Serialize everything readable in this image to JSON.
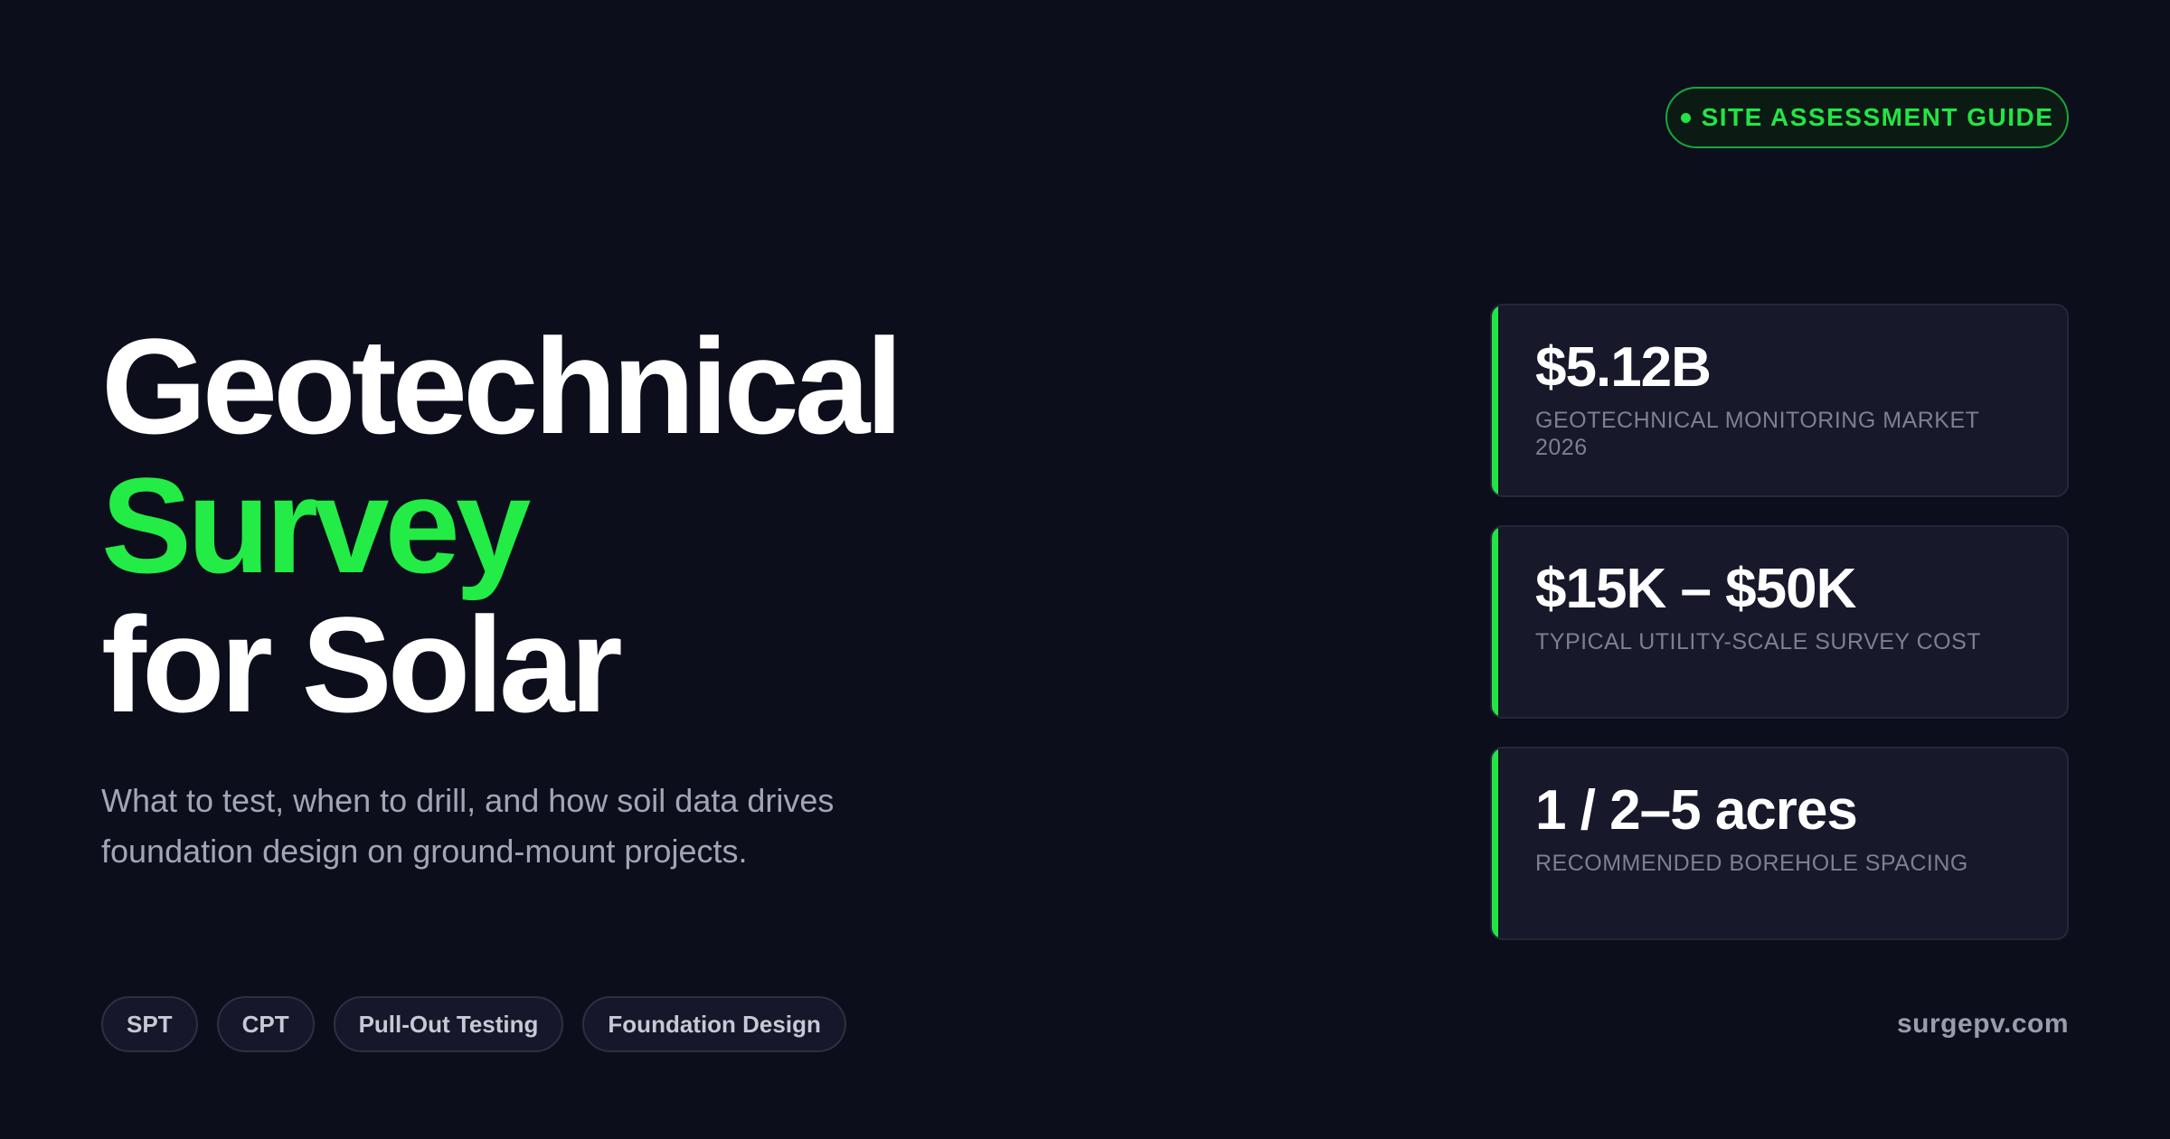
{
  "badge": {
    "label": "SITE ASSESSMENT GUIDE"
  },
  "headline": {
    "line1": "Geotechnical",
    "line2": "Survey",
    "line3": "for Solar"
  },
  "subtitle": "What to test, when to drill, and how soil data drives foundation design on ground-mount projects.",
  "stats": [
    {
      "value": "$5.12B",
      "label": "GEOTECHNICAL MONITORING MARKET 2026"
    },
    {
      "value": "$15K – $50K",
      "label": "TYPICAL UTILITY-SCALE SURVEY COST"
    },
    {
      "value": "1 / 2–5 acres",
      "label": "RECOMMENDED BOREHOLE SPACING"
    }
  ],
  "tags": [
    "SPT",
    "CPT",
    "Pull-Out Testing",
    "Foundation Design"
  ],
  "site": "surgepv.com",
  "colors": {
    "background": "#0d0e1c",
    "accent": "#22ec45",
    "card": "#17182a"
  }
}
